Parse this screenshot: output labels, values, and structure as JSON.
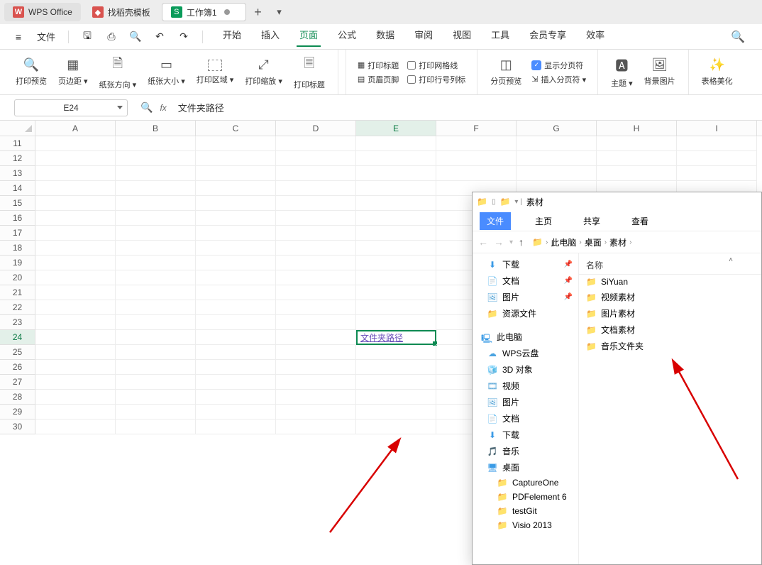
{
  "tabs": {
    "office": "WPS Office",
    "template": "找稻壳模板",
    "workbook": "工作簿1"
  },
  "menu": {
    "file": "文件",
    "items": [
      "开始",
      "插入",
      "页面",
      "公式",
      "数据",
      "审阅",
      "视图",
      "工具",
      "会员专享",
      "效率"
    ],
    "active_index": 2
  },
  "ribbon": {
    "print_preview": "打印预览",
    "margins": "页边距",
    "orientation": "纸张方向",
    "size": "纸张大小",
    "print_area": "打印区域",
    "print_scale": "打印缩放",
    "print_title": "打印标题",
    "header_footer": "页眉页脚",
    "print_gridlines": "打印网格线",
    "print_row_col_headers": "打印行号列标",
    "page_break_preview": "分页预览",
    "show_page_breaks": "显示分页符",
    "insert_page_break": "插入分页符",
    "theme": "主题",
    "background": "背景图片",
    "table_beautify": "表格美化"
  },
  "formula_bar": {
    "cell_ref": "E24",
    "value": "文件夹路径"
  },
  "sheet": {
    "columns": [
      "A",
      "B",
      "C",
      "D",
      "E",
      "F",
      "G",
      "H",
      "I"
    ],
    "row_start": 11,
    "row_end": 30,
    "active_col": "E",
    "active_row": 24,
    "active_cell_value": "文件夹路径"
  },
  "explorer": {
    "title": "素材",
    "menu": {
      "file": "文件",
      "main": "主页",
      "share": "共享",
      "view": "查看"
    },
    "breadcrumb": [
      "此电脑",
      "桌面",
      "素材"
    ],
    "tree": {
      "quick": [
        {
          "label": "下载",
          "icon": "download",
          "pinned": true
        },
        {
          "label": "文档",
          "icon": "docs",
          "pinned": true
        },
        {
          "label": "图片",
          "icon": "pics",
          "pinned": true
        },
        {
          "label": "资源文件",
          "icon": "folder",
          "pinned": false
        }
      ],
      "pc_label": "此电脑",
      "pc_items": [
        {
          "label": "WPS云盘",
          "icon": "cloud"
        },
        {
          "label": "3D 对象",
          "icon": "d3"
        },
        {
          "label": "视频",
          "icon": "vid"
        },
        {
          "label": "图片",
          "icon": "pics"
        },
        {
          "label": "文档",
          "icon": "docs"
        },
        {
          "label": "下载",
          "icon": "download"
        },
        {
          "label": "音乐",
          "icon": "music"
        },
        {
          "label": "桌面",
          "icon": "desktop"
        }
      ],
      "desktop_items": [
        {
          "label": "CaptureOne"
        },
        {
          "label": "PDFelement 6"
        },
        {
          "label": "testGit"
        },
        {
          "label": "Visio 2013"
        }
      ]
    },
    "list": {
      "header_name": "名称",
      "items": [
        "SiYuan",
        "视频素材",
        "图片素材",
        "文档素材",
        "音乐文件夹"
      ]
    }
  }
}
